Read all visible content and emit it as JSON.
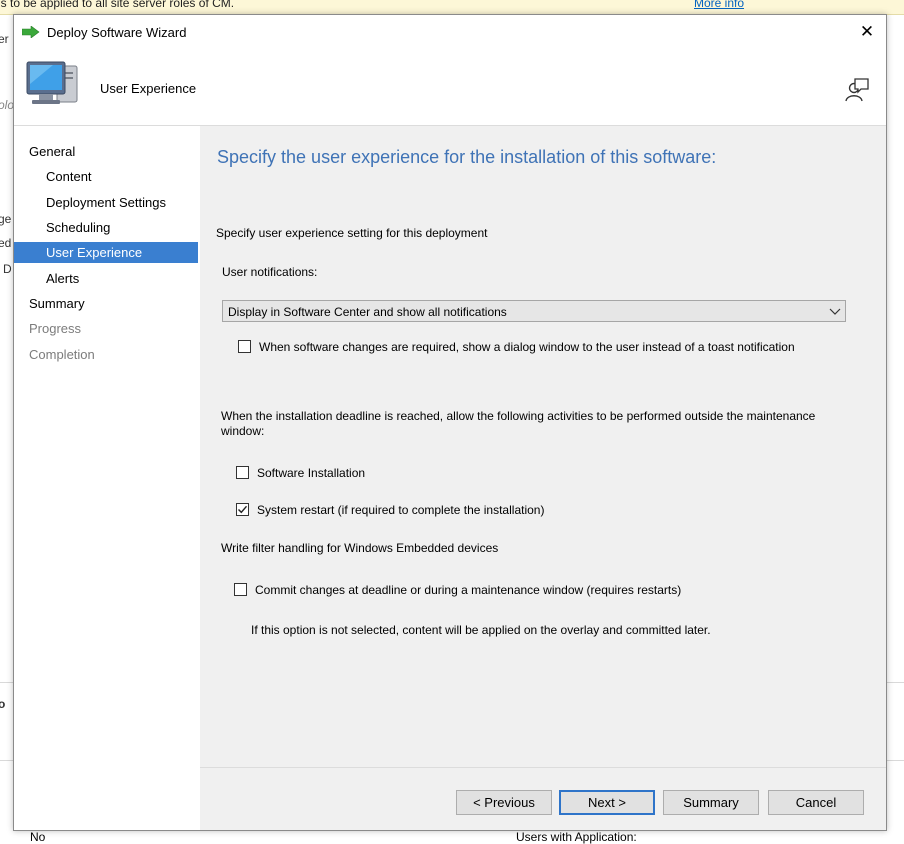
{
  "background": {
    "infobar_text": "is to be applied to all site server roles of CM.",
    "infobar_link": "More info",
    "left_fragments": [
      "er",
      "olo",
      "ge",
      "ed",
      "D",
      "o"
    ],
    "footer_left": "No",
    "footer_right": "Users with Application:"
  },
  "dialog": {
    "title": "Deploy Software Wizard",
    "close_glyph": "✕",
    "header_title": "User Experience"
  },
  "nav": {
    "items": [
      {
        "label": "General",
        "state": "normal"
      },
      {
        "label": "Content",
        "state": "normal"
      },
      {
        "label": "Deployment Settings",
        "state": "normal"
      },
      {
        "label": "Scheduling",
        "state": "normal"
      },
      {
        "label": "User Experience",
        "state": "selected"
      },
      {
        "label": "Alerts",
        "state": "normal"
      },
      {
        "label": "Summary",
        "state": "normal"
      },
      {
        "label": "Progress",
        "state": "disabled"
      },
      {
        "label": "Completion",
        "state": "disabled"
      }
    ]
  },
  "main": {
    "heading": "Specify the user experience for the installation of this software:",
    "intro": "Specify user experience setting for this deployment",
    "notifications_label": "User notifications:",
    "notifications_value": "Display in Software Center and show all notifications",
    "dialog_window_option": {
      "label": "When software changes are required, show a dialog window to the user instead of a toast notification",
      "checked": false
    },
    "deadline_text_line1": "When the installation deadline is reached, allow the following activities to be performed outside the maintenance",
    "deadline_text_line2": "window:",
    "software_installation": {
      "label": "Software Installation",
      "checked": false
    },
    "system_restart": {
      "label": "System restart  (if required to complete the installation)",
      "checked": true
    },
    "write_filter_heading": "Write filter handling for Windows Embedded devices",
    "commit_changes": {
      "label": "Commit changes at deadline or during a maintenance window (requires restarts)",
      "checked": false
    },
    "commit_note": "If this option is not selected, content will be applied on the overlay and committed later."
  },
  "buttons": {
    "previous": "< Previous",
    "next": "Next >",
    "summary": "Summary",
    "cancel": "Cancel"
  },
  "colors": {
    "heading_blue": "#3f73b6",
    "nav_selected": "#3a7fd0",
    "content_bg": "#f0f0f0"
  }
}
